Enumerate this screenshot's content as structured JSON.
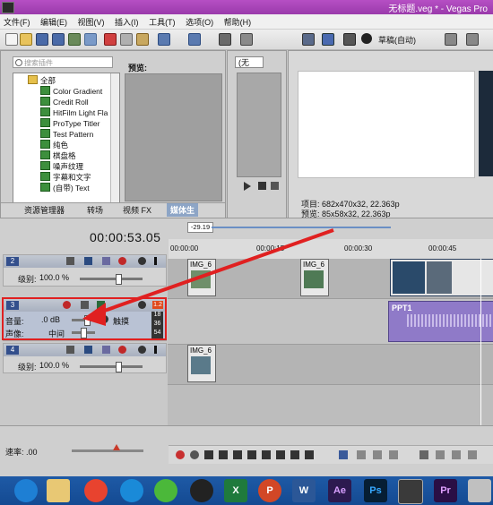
{
  "window": {
    "title": "无标题.veg * - Vegas Pro"
  },
  "menu": [
    "文件(F)",
    "编辑(E)",
    "视图(V)",
    "插入(I)",
    "工具(T)",
    "选项(O)",
    "帮助(H)"
  ],
  "explorer": {
    "search_placeholder": "搜索插件",
    "preview_label": "预览:",
    "root": "全部",
    "items": [
      "Color Gradient",
      "Credit Roll",
      "HitFilm Light Fla",
      "ProType Titler",
      "Test Pattern",
      "纯色",
      "棋盘格",
      "噪声纹理",
      "字幕和文字",
      "(自带) Text"
    ],
    "tabs": [
      "资源管理器",
      "转场",
      "视频 FX",
      "媒体生"
    ]
  },
  "trimmer": {
    "select_value": "(无"
  },
  "video_preview": {
    "mode": "草稿(自动)",
    "project_label": "项目: 682x470x32, 22.363p",
    "preview_label": "预览: 85x58x32, 22.363p",
    "preview_selected": "85x58x32, 22.363p"
  },
  "timeline": {
    "timecode": "00:00:53.05",
    "marker": "-29.19",
    "ruler": [
      "00:00:00",
      "00:00:15",
      "00:00:30",
      "00:00:45"
    ],
    "tracks": [
      {
        "num": "2",
        "level_label": "级别:",
        "level_value": "100.0 %"
      },
      {
        "num": "3",
        "volume_label": "音量:",
        "volume_value": ".0 dB",
        "pan_label": "声像:",
        "pan_value": "中间",
        "mode": "触摸",
        "meter": [
          "1.2",
          "18",
          "36",
          "54"
        ]
      },
      {
        "num": "4",
        "level_label": "级别:",
        "level_value": "100.0 %"
      }
    ],
    "clips": [
      "IMG_6",
      "IMG_6",
      "IMG_6",
      "PPT1"
    ]
  },
  "bottom": {
    "rate": "速率: .00"
  },
  "taskbar": [
    "Ae",
    "Ps",
    "Pr",
    "W",
    "P",
    "X"
  ],
  "colors": {
    "title": "#a844b8",
    "highlight": "#e02020",
    "audio_clip": "#8f7ac8"
  }
}
